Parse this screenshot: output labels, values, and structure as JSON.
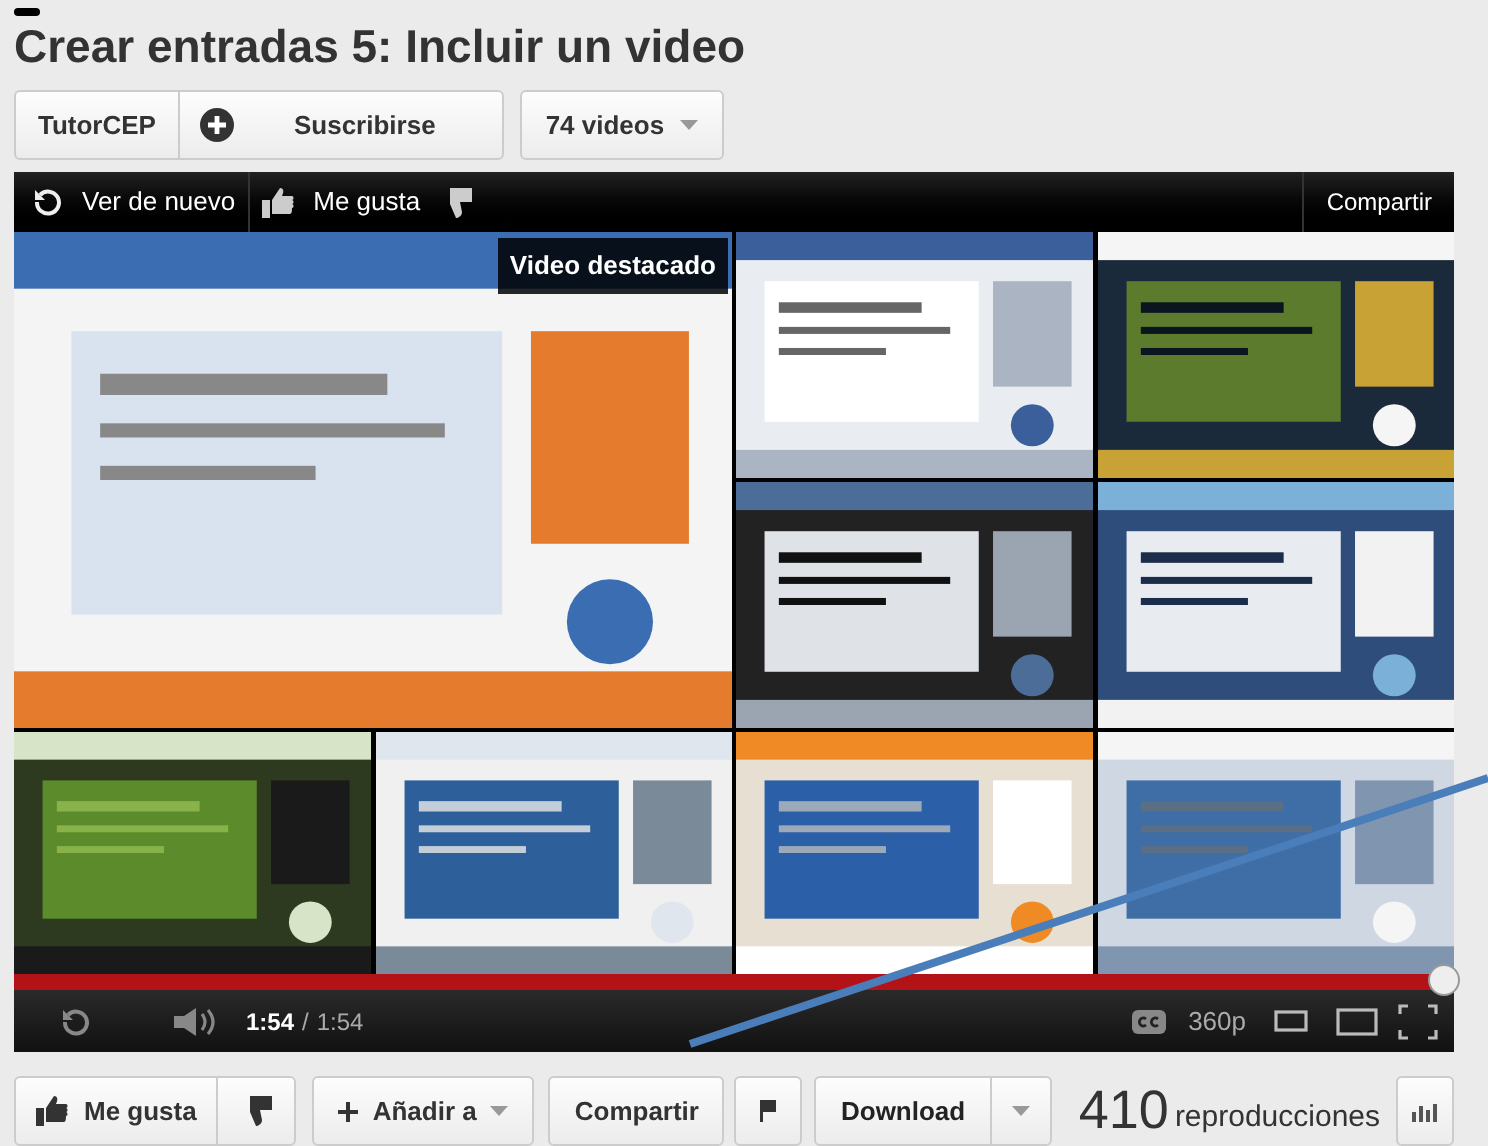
{
  "video_title": "Crear entradas 5: Incluir un video",
  "channel": {
    "name": "TutorCEP",
    "subscribe": "Suscribirse",
    "videos": "74 videos"
  },
  "player": {
    "replay": "Ver de nuevo",
    "like": "Me gusta",
    "share": "Compartir",
    "featured": "Video destacado",
    "progress": {
      "level": 1
    },
    "time_current": "1:54",
    "time_separator": "/",
    "time_total": "1:54",
    "quality": "360p"
  },
  "actions": {
    "like": "Me gusta",
    "add_to": "Añadir a",
    "share": "Compartir",
    "download": "Download"
  },
  "views": {
    "count": "410",
    "label": "reproducciones"
  }
}
